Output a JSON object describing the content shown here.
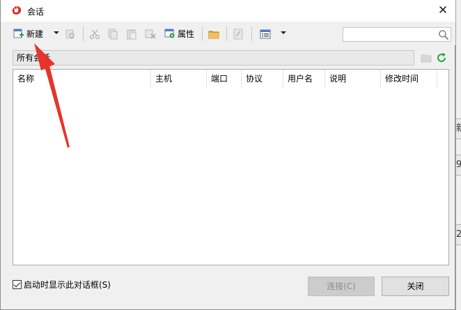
{
  "background_app": {
    "cells": [
      "新",
      "9",
      "2"
    ]
  },
  "window": {
    "title": "会话",
    "close_label": "✕"
  },
  "toolbar": {
    "new_label": "新建",
    "properties_label": "属性",
    "search": {
      "value": "",
      "placeholder": ""
    }
  },
  "folder": {
    "path": "所有会话"
  },
  "table": {
    "columns": [
      "名称",
      "主机",
      "端口",
      "协议",
      "用户名",
      "说明",
      "修改时间"
    ],
    "rows": []
  },
  "footer": {
    "startup_checkbox_label": "启动时显示此对话框(S)",
    "startup_checked": true,
    "connect_label": "连接(C)",
    "close_label": "关闭"
  },
  "colors": {
    "annotation_arrow": "#e8322b",
    "toolbar_icon_green": "#2e9e3a",
    "refresh_green": "#27a23a"
  }
}
